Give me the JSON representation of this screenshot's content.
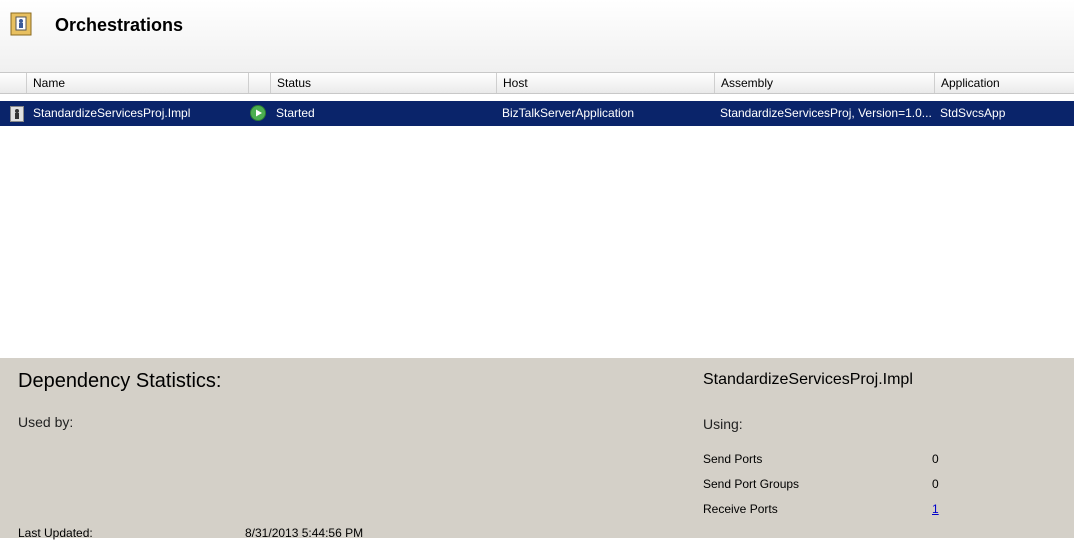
{
  "header": {
    "title": "Orchestrations",
    "icon": "orchestrations-folder-icon"
  },
  "columns": [
    "Name",
    "Status",
    "Host",
    "Assembly",
    "Application"
  ],
  "rows": [
    {
      "name": "StandardizeServicesProj.Impl",
      "status": "Started",
      "host": "BizTalkServerApplication",
      "assembly": "StandardizeServicesProj, Version=1.0...",
      "application": "StdSvcsApp"
    }
  ],
  "dependency": {
    "title": "Dependency Statistics:",
    "selected_name": "StandardizeServicesProj.Impl",
    "used_by_label": "Used by:",
    "using_label": "Using:",
    "stats": [
      {
        "label": "Send Ports",
        "value": "0"
      },
      {
        "label": "Send Port Groups",
        "value": "0"
      },
      {
        "label": "Receive Ports",
        "value": "1"
      }
    ],
    "last_updated_label": "Last Updated:",
    "last_updated_value": "8/31/2013 5:44:56 PM"
  },
  "colors": {
    "selection": "#0a246a",
    "panel": "#d4d0c8",
    "link": "#0000cc",
    "status_icon": "#4caf50"
  }
}
